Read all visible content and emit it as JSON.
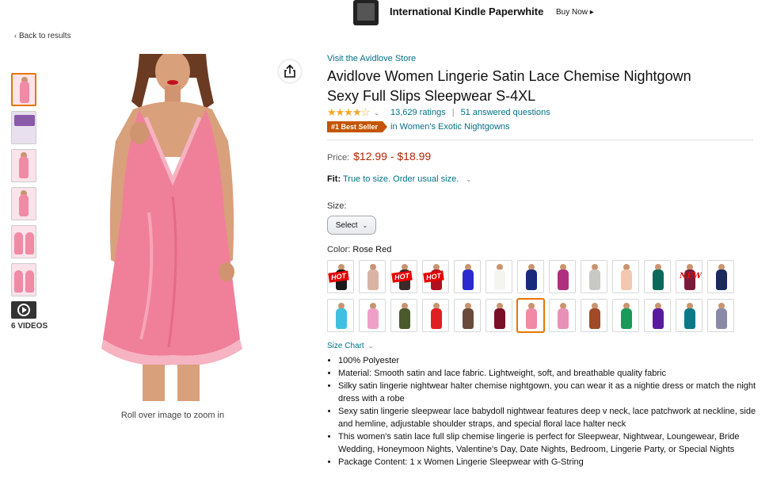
{
  "banner": {
    "title": "International Kindle Paperwhite",
    "cta": "Buy Now ▸"
  },
  "nav": {
    "back": "Back to results"
  },
  "gallery": {
    "videos_label": "6 VIDEOS",
    "zoom_hint": "Roll over image to zoom in"
  },
  "product": {
    "store_link": "Visit the Avidlove Store",
    "title_line1": "Avidlove Women Lingerie Satin Lace Chemise Nightgown",
    "title_line2": "Sexy Full Slips Sleepwear S-4XL",
    "stars": "★★★★☆",
    "rating": 4.3,
    "ratings_count": "13,629 ratings",
    "answered_questions": "51 answered questions",
    "badge": "#1 Best Seller",
    "badge_category": "in Women's Exotic Nightgowns",
    "price_label": "Price:",
    "price": "$12.99 - $18.99",
    "fit_label": "Fit:",
    "fit_value": "True to size. Order usual size.",
    "size_label": "Size:",
    "size_select": "Select",
    "color_label": "Color:",
    "color_value": "Rose Red",
    "size_chart": "Size Chart",
    "bullets": [
      "100% Polyester",
      "Material: Smooth satin and lace fabric. Lightweight, soft, and breathable quality fabric",
      "Silky satin lingerie nightwear halter chemise nightgown, you can wear it as a nightie dress or match the night dress with a robe",
      "Sexy satin lingerie sleepwear lace babydoll nightwear features deep v neck, lace patchwork at neckline, side and hemline, adjustable shoulder straps, and special floral lace halter neck",
      "This women's satin lace full slip chemise lingerie is perfect for Sleepwear, Nightwear, Loungewear, Bride Wedding, Honeymoon Nights, Valentine's Day, Date Nights, Bedroom, Lingerie Party, or Special Nights",
      "Package Content: 1 x Women Lingerie Sleepwear with G-String"
    ]
  },
  "swatches": [
    {
      "color": "#1a1a1a",
      "tag": "HOT"
    },
    {
      "color": "#d9b3a3",
      "tag": ""
    },
    {
      "color": "#3a2a2a",
      "tag": "HOT"
    },
    {
      "color": "#b01020",
      "tag": "HOT"
    },
    {
      "color": "#2a2ad0",
      "tag": ""
    },
    {
      "color": "#f4f4f0",
      "tag": ""
    },
    {
      "color": "#1a2a7a",
      "tag": ""
    },
    {
      "color": "#b03080",
      "tag": ""
    },
    {
      "color": "#c8c8c4",
      "tag": ""
    },
    {
      "color": "#f2c8b0",
      "tag": ""
    },
    {
      "color": "#0a6a5a",
      "tag": ""
    },
    {
      "color": "#7a1a3a",
      "tag": "NEW"
    },
    {
      "color": "#1a2a5a",
      "tag": ""
    },
    {
      "color": "#40c0e0",
      "tag": ""
    },
    {
      "color": "#f0a0c8",
      "tag": ""
    },
    {
      "color": "#4a5a2a",
      "tag": ""
    },
    {
      "color": "#e02020",
      "tag": ""
    },
    {
      "color": "#6a4a3a",
      "tag": ""
    },
    {
      "color": "#7a1028",
      "tag": ""
    },
    {
      "color": "#f08aa5",
      "tag": "",
      "selected": true
    },
    {
      "color": "#e890b8",
      "tag": ""
    },
    {
      "color": "#a04a2a",
      "tag": ""
    },
    {
      "color": "#1a9a5a",
      "tag": ""
    },
    {
      "color": "#5a1aa0",
      "tag": ""
    },
    {
      "color": "#0a7a8a",
      "tag": ""
    },
    {
      "color": "#8a8aa8",
      "tag": ""
    }
  ],
  "colors": {
    "link": "#007185",
    "price": "#b12704",
    "badge": "#c45500",
    "selected": "#e77600"
  }
}
